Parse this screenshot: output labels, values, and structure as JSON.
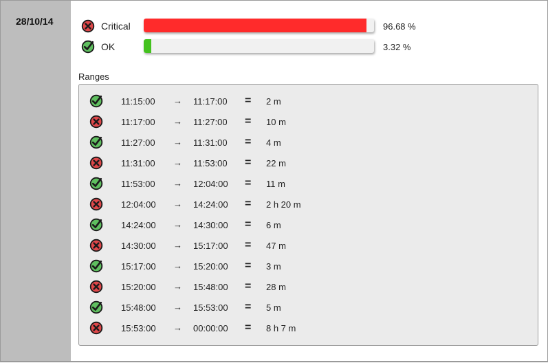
{
  "date": "28/10/14",
  "colors": {
    "critical": "#ff2b2b",
    "ok": "#44c21f",
    "icon_critical_fill": "#e0484a",
    "icon_ok_fill": "#5fbf5f",
    "icon_stroke": "#1a1a1a"
  },
  "statuses": [
    {
      "icon": "critical-x-icon",
      "label": "Critical",
      "percent_text": "96.68 %",
      "fraction": 0.9668
    },
    {
      "icon": "ok-check-icon",
      "label": "OK",
      "percent_text": "3.32 %",
      "fraction": 0.0332
    }
  ],
  "ranges_title": "Ranges",
  "ranges": [
    {
      "status": "ok",
      "start": "11:15:00",
      "arrow": "→",
      "end": "11:17:00",
      "eq": "=",
      "duration": "2 m"
    },
    {
      "status": "critical",
      "start": "11:17:00",
      "arrow": "→",
      "end": "11:27:00",
      "eq": "=",
      "duration": "10 m"
    },
    {
      "status": "ok",
      "start": "11:27:00",
      "arrow": "→",
      "end": "11:31:00",
      "eq": "=",
      "duration": "4 m"
    },
    {
      "status": "critical",
      "start": "11:31:00",
      "arrow": "→",
      "end": "11:53:00",
      "eq": "=",
      "duration": "22 m"
    },
    {
      "status": "ok",
      "start": "11:53:00",
      "arrow": "→",
      "end": "12:04:00",
      "eq": "=",
      "duration": "11 m"
    },
    {
      "status": "critical",
      "start": "12:04:00",
      "arrow": "→",
      "end": "14:24:00",
      "eq": "=",
      "duration": "2 h 20 m"
    },
    {
      "status": "ok",
      "start": "14:24:00",
      "arrow": "→",
      "end": "14:30:00",
      "eq": "=",
      "duration": "6 m"
    },
    {
      "status": "critical",
      "start": "14:30:00",
      "arrow": "→",
      "end": "15:17:00",
      "eq": "=",
      "duration": "47 m"
    },
    {
      "status": "ok",
      "start": "15:17:00",
      "arrow": "→",
      "end": "15:20:00",
      "eq": "=",
      "duration": "3 m"
    },
    {
      "status": "critical",
      "start": "15:20:00",
      "arrow": "→",
      "end": "15:48:00",
      "eq": "=",
      "duration": "28 m"
    },
    {
      "status": "ok",
      "start": "15:48:00",
      "arrow": "→",
      "end": "15:53:00",
      "eq": "=",
      "duration": "5 m"
    },
    {
      "status": "critical",
      "start": "15:53:00",
      "arrow": "→",
      "end": "00:00:00",
      "eq": "=",
      "duration": "8 h 7 m"
    }
  ]
}
